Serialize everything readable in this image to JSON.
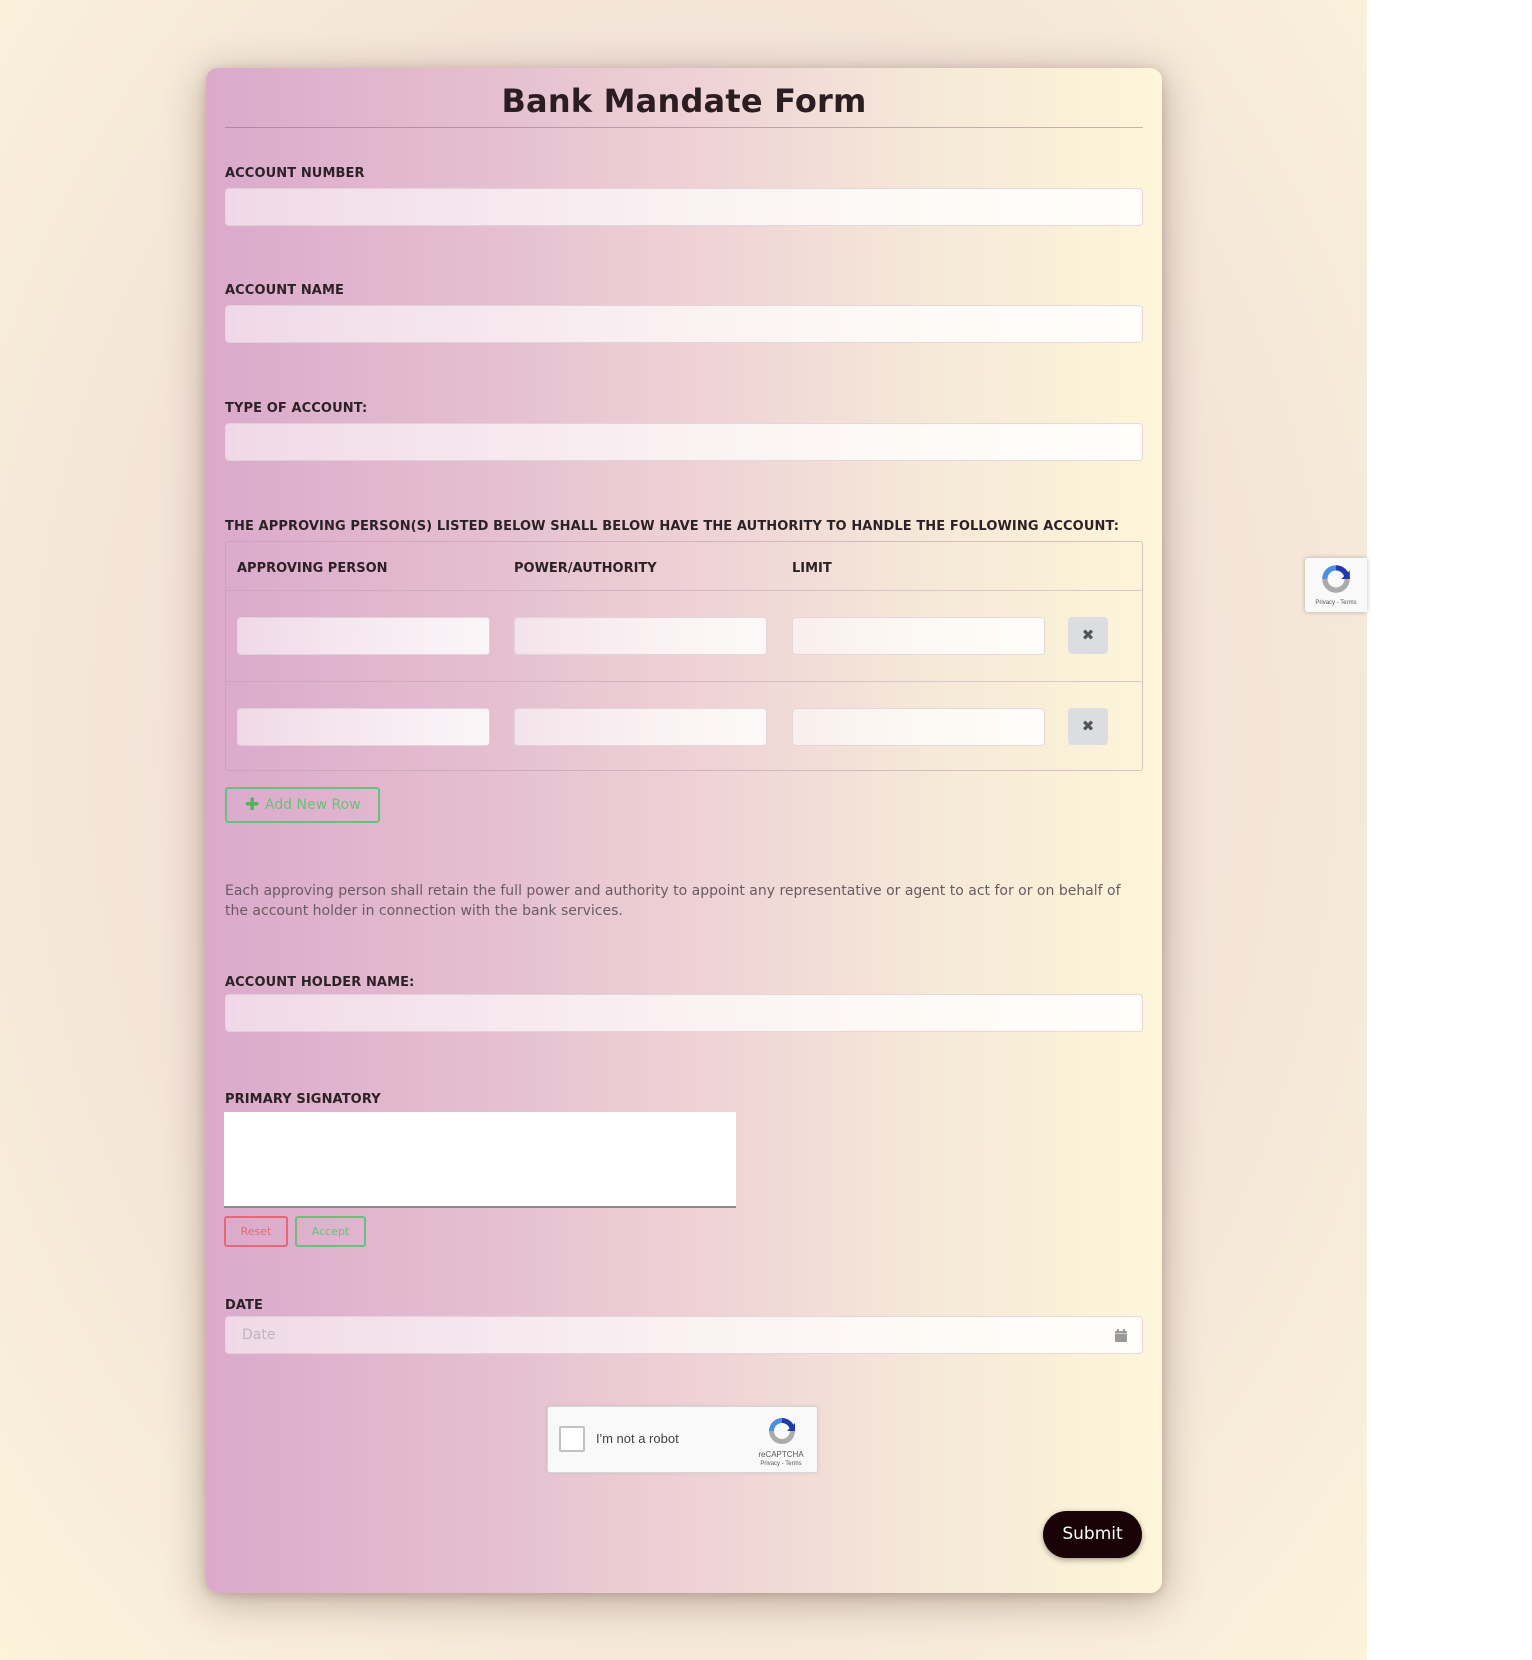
{
  "form": {
    "title": "Bank Mandate Form",
    "fields": {
      "account_number": {
        "label": "ACCOUNT NUMBER",
        "value": ""
      },
      "account_name": {
        "label": "ACCOUNT NAME",
        "value": ""
      },
      "type_of_account": {
        "label": "TYPE OF ACCOUNT:",
        "value": ""
      }
    },
    "approvers": {
      "label": "THE APPROVING PERSON(S) LISTED BELOW SHALL BELOW HAVE THE AUTHORITY TO HANDLE THE FOLLOWING ACCOUNT:",
      "columns": [
        "APPROVING PERSON",
        "POWER/AUTHORITY",
        "LIMIT"
      ],
      "rows": [
        {
          "approving_person": "",
          "power_authority": "",
          "limit": "",
          "delete_icon": "times-icon",
          "delete_glyph": "✖"
        },
        {
          "approving_person": "",
          "power_authority": "",
          "limit": "",
          "delete_icon": "times-icon",
          "delete_glyph": "✖"
        }
      ],
      "add_row": {
        "label": "Add New Row",
        "icon": "plus-icon",
        "glyph": "✚"
      }
    },
    "statement": "Each approving person shall retain the full power and authority to appoint any representative or agent to act for or on behalf of the account holder in connection with the bank services.",
    "account_holder_name": {
      "label": "ACCOUNT HOLDER NAME:",
      "value": ""
    },
    "primary_signatory": {
      "label": "PRIMARY SIGNATORY",
      "reset_label": "Reset",
      "accept_label": "Accept"
    },
    "date": {
      "label": "DATE",
      "placeholder": "Date",
      "value": "",
      "icon": "calendar-icon"
    },
    "recaptcha": {
      "checkbox_label": "I'm not a robot",
      "brand": "reCAPTCHA",
      "links": "Privacy - Terms",
      "checked": false
    },
    "submit_label": "Submit"
  },
  "recaptcha_badge": {
    "links": "Privacy - Terms"
  },
  "colors": {
    "accent_green": "#6cbf7b",
    "accent_red": "#e06a78",
    "submit_bg": "#1a0308",
    "title_text": "#2a1e22"
  }
}
